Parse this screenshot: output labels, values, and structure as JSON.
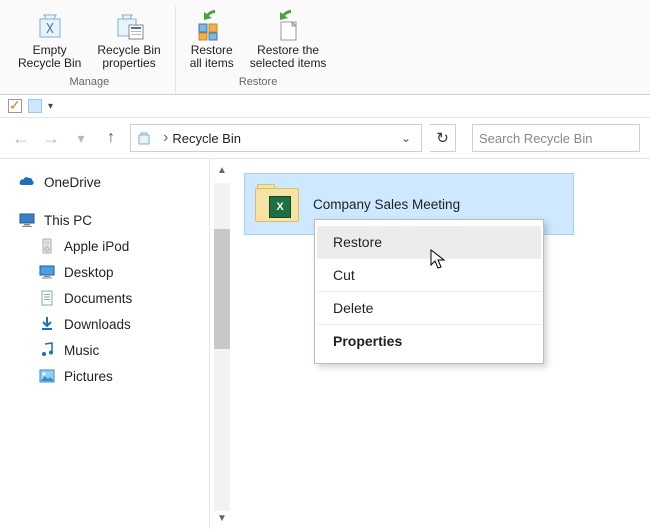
{
  "ribbon": {
    "manage": {
      "title": "Manage",
      "empty": "Empty\nRecycle Bin",
      "props": "Recycle Bin\nproperties"
    },
    "restore": {
      "title": "Restore",
      "all": "Restore\nall items",
      "selected": "Restore the\nselected items"
    }
  },
  "breadcrumb": {
    "location": "Recycle Bin"
  },
  "search": {
    "placeholder": "Search Recycle Bin"
  },
  "sidebar": {
    "onedrive": "OneDrive",
    "thispc": "This PC",
    "items": [
      {
        "label": "Apple iPod"
      },
      {
        "label": "Desktop"
      },
      {
        "label": "Documents"
      },
      {
        "label": "Downloads"
      },
      {
        "label": "Music"
      },
      {
        "label": "Pictures"
      }
    ]
  },
  "file": {
    "name": "Company Sales Meeting"
  },
  "context": {
    "restore": "Restore",
    "cut": "Cut",
    "delete": "Delete",
    "properties": "Properties"
  }
}
